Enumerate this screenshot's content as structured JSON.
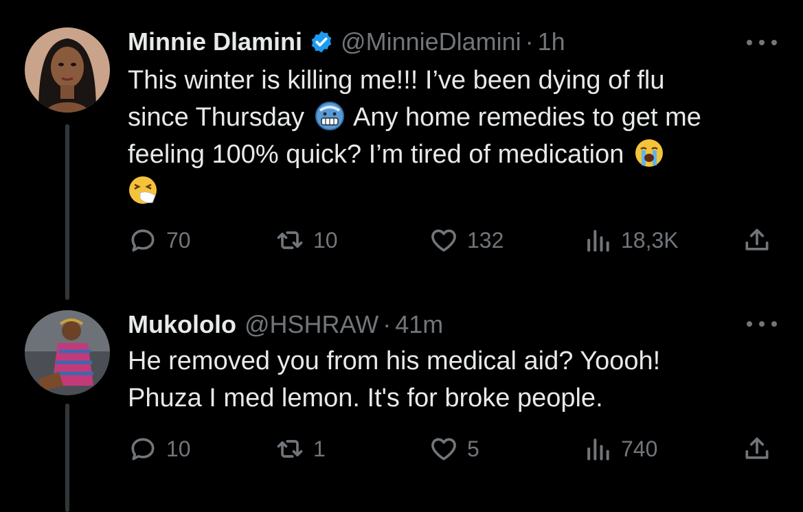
{
  "tweets": [
    {
      "name": "Minnie Dlamini",
      "verified": true,
      "handle": "@MinnieDlamini",
      "separator": "·",
      "time": "1h",
      "text_line1": "This winter is killing me!!! I’ve been dying of flu",
      "text_line2a": "since Thursday",
      "text_line2b": "Any home remedies to get me",
      "text_line3": "feeling 100% quick? I’m tired of medication",
      "emojis": [
        "cold-face",
        "loudly-crying-face",
        "sneezing-face"
      ],
      "replies": "70",
      "retweets": "10",
      "likes": "132",
      "views": "18,3K"
    },
    {
      "name": "Mukololo",
      "verified": false,
      "handle": "@HSHRAW",
      "separator": "·",
      "time": "41m",
      "text_line1": "He removed you from his medical aid? Yoooh!",
      "text_line2": "Phuza I med lemon. It's for broke people.",
      "replies": "10",
      "retweets": "1",
      "likes": "5",
      "views": "740"
    }
  ],
  "colors": {
    "background": "#000000",
    "text": "#e7e9ea",
    "secondary": "#71767b",
    "verified": "#1d9bf0",
    "thread_line": "#333639"
  }
}
